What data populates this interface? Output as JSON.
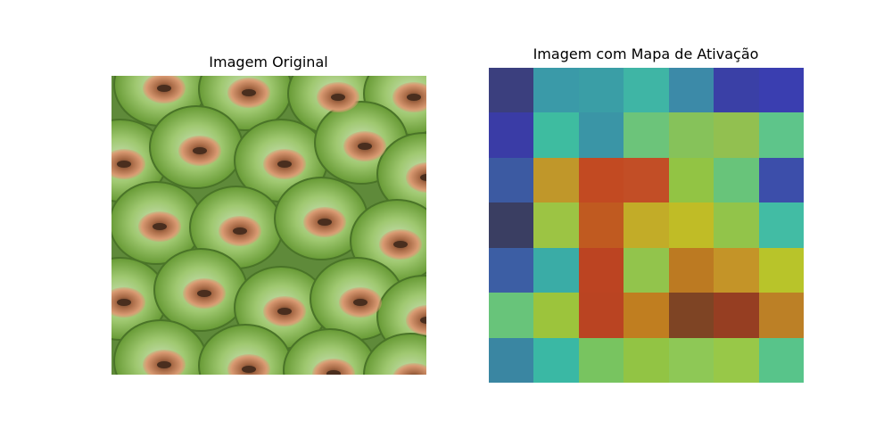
{
  "panels": {
    "left_title": "Imagem Original",
    "right_title": "Imagem com Mapa de Ativação"
  },
  "image_description": "close-up texture of green pineapple fruit skin with orange-brown scaly centers",
  "heatmap": {
    "rows": 7,
    "cols": 7,
    "colors": [
      [
        "#3b3f7e",
        "#3a9aa8",
        "#3a9ea6",
        "#3fb5a5",
        "#3c8aa8",
        "#3a40a6",
        "#3a3eb0"
      ],
      [
        "#3a3ca6",
        "#3ebca0",
        "#3a95a6",
        "#6cc47a",
        "#86c25a",
        "#92c050",
        "#5ec58a"
      ],
      [
        "#3c5aa2",
        "#c0972a",
        "#c24a22",
        "#c24e26",
        "#92c444",
        "#68c47a",
        "#3c4eaa"
      ],
      [
        "#3a3e62",
        "#9cc444",
        "#c05a20",
        "#c2ac28",
        "#c0bc26",
        "#92c44a",
        "#42bca4"
      ],
      [
        "#3c5ea4",
        "#3aaca6",
        "#bc4422",
        "#92c44c",
        "#bc7a22",
        "#c49428",
        "#b8c42a"
      ],
      [
        "#68c47a",
        "#9cc43c",
        "#ba4422",
        "#c07e20",
        "#7e4424",
        "#963e22",
        "#bc8026"
      ],
      [
        "#3a86a2",
        "#3ab8a4",
        "#78c460",
        "#92c444",
        "#8ec856",
        "#98c848",
        "#58c48a"
      ]
    ]
  }
}
